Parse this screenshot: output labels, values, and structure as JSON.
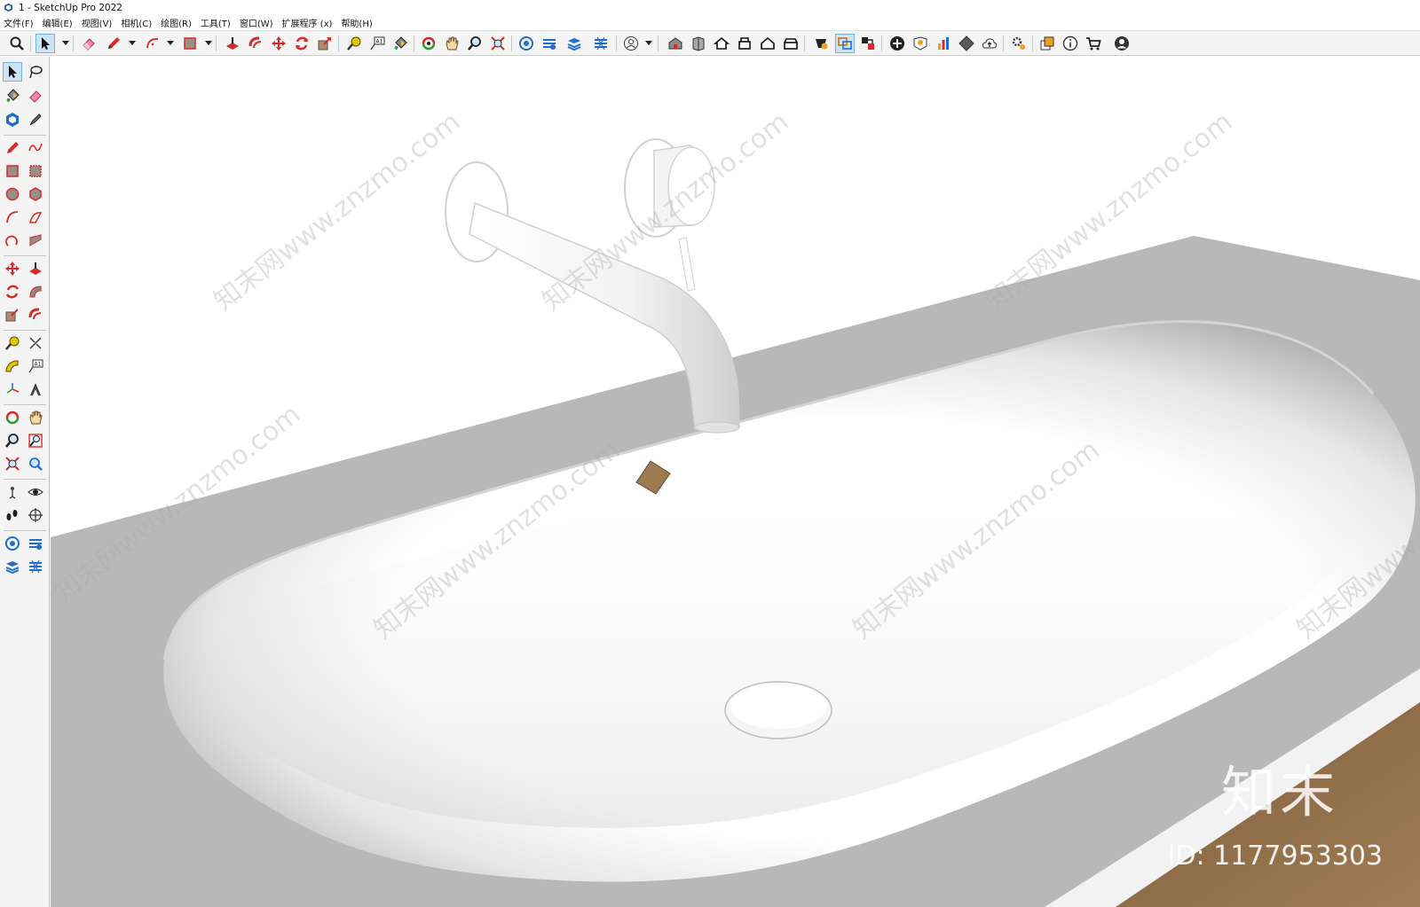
{
  "window": {
    "title": "1 - SketchUp Pro 2022"
  },
  "menu": [
    "文件(F)",
    "编辑(E)",
    "视图(V)",
    "相机(C)",
    "绘图(R)",
    "工具(T)",
    "窗口(W)",
    "扩展程序 (x)",
    "帮助(H)"
  ],
  "toolbar": {
    "items": [
      {
        "name": "search-icon"
      },
      {
        "name": "select-icon"
      },
      {
        "name": "eraser-icon"
      },
      {
        "name": "pencil-icon"
      },
      {
        "name": "arc-icon"
      },
      {
        "name": "rectangle-icon"
      },
      {
        "name": "push-pull-icon"
      },
      {
        "name": "offset-icon"
      },
      {
        "name": "move-icon"
      },
      {
        "name": "rotate-icon"
      },
      {
        "name": "scale-icon"
      },
      {
        "name": "tape-measure-icon"
      },
      {
        "name": "text-icon"
      },
      {
        "name": "paint-bucket-icon"
      },
      {
        "name": "orbit-icon"
      },
      {
        "name": "pan-icon"
      },
      {
        "name": "zoom-icon"
      },
      {
        "name": "zoom-extents-icon"
      },
      {
        "name": "section-plane-icon"
      },
      {
        "name": "sandbox-icon"
      },
      {
        "name": "layers-icon"
      },
      {
        "name": "smoove-icon"
      },
      {
        "name": "user-profile-icon"
      },
      {
        "name": "warehouse-icon"
      },
      {
        "name": "3d-warehouse-icon"
      },
      {
        "name": "home-icon"
      },
      {
        "name": "components-icon"
      },
      {
        "name": "house-outline-icon"
      },
      {
        "name": "styles-icon"
      },
      {
        "name": "extension-manager-icon"
      },
      {
        "name": "sync-icon"
      },
      {
        "name": "scenes-icon"
      },
      {
        "name": "add-location-icon"
      },
      {
        "name": "geo-icon"
      },
      {
        "name": "chart-icon"
      },
      {
        "name": "checker-icon"
      },
      {
        "name": "cloud-upload-icon"
      },
      {
        "name": "settings-icon"
      },
      {
        "name": "layout-icon"
      },
      {
        "name": "info-icon"
      },
      {
        "name": "cart-icon"
      },
      {
        "name": "account-icon"
      }
    ]
  },
  "watermarks": {
    "diagonal": "知末网www.znzmo.com",
    "logo": "知末",
    "id_label": "ID: 1177953303"
  },
  "colors": {
    "accent_red": "#d72b2b",
    "countertop": "#b8b8b8",
    "basin": "#ffffff",
    "wood": "#9c7a52"
  }
}
